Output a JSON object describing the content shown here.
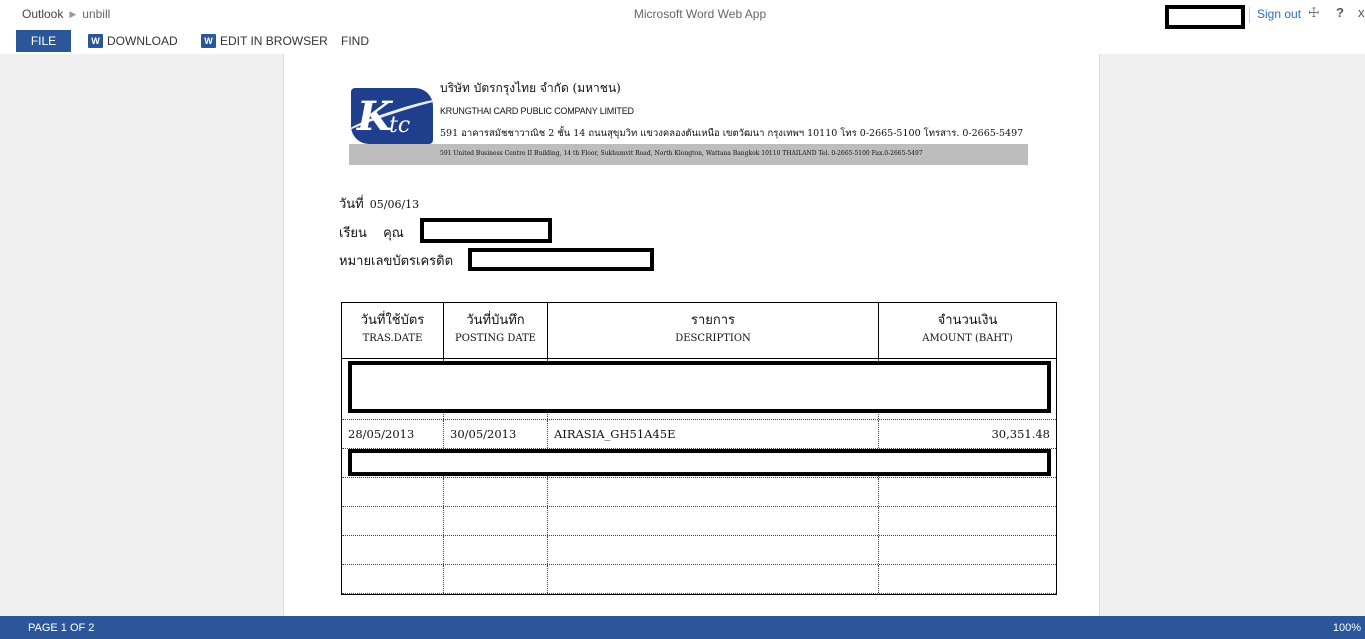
{
  "header": {
    "breadcrumb_root": "Outlook",
    "breadcrumb_doc": "unbill",
    "app_title": "Microsoft Word Web App",
    "sign_out": "Sign out",
    "help": "?",
    "close": "x"
  },
  "ribbon": {
    "file": "FILE",
    "download": "DOWNLOAD",
    "edit_in_browser": "EDIT IN BROWSER",
    "find": "FIND"
  },
  "letterhead": {
    "company_thai": "บริษัท บัตรกรุงไทย จำกัด (มหาชน)",
    "company_en": "KRUNGTHAI CARD PUBLIC COMPANY LIMITED",
    "address_thai": "591 อาคารสมัชชาวาณิช 2 ชั้น 14 ถนนสุขุมวิท แขวงคลองตันเหนือ เขตวัฒนา กรุงเทพฯ 10110 โทร 0-2665-5100 โทรสาร. 0-2665-5497",
    "address_en": "591 United Business Centre II Building, 14 th Floor, Sukhumvit Road, North Klongton, Wattana Bangkok 10110 THAILAND Tel. 0-2665-5100 Fax.0-2665-5497",
    "logo_text": "Ktc"
  },
  "letter": {
    "date_label": "วันที่",
    "date_value": "05/06/13",
    "dear_label": "เรียน",
    "khun_label": "คุณ",
    "card_label": "หมายเลขบัตรเครดิต"
  },
  "table": {
    "headers": [
      {
        "thai": "วันที่ใช้บัตร",
        "eng": "TRAS.DATE"
      },
      {
        "thai": "วันที่บันทึก",
        "eng": "POSTING DATE"
      },
      {
        "thai": "รายการ",
        "eng": "DESCRIPTION"
      },
      {
        "thai": "จำนวนเงิน",
        "eng": "AMOUNT (BAHT)"
      }
    ],
    "rows": [
      {
        "tras_date": "28/05/2013",
        "posting_date": "30/05/2013",
        "description": "AIRASIA_GH51A45E",
        "amount": "30,351.48"
      }
    ]
  },
  "status": {
    "page": "PAGE 1 OF 2",
    "zoom": "100%"
  },
  "colors": {
    "brand_blue": "#2b579a",
    "link_blue": "#2a6ebb",
    "logo_blue": "#1f3f8c"
  }
}
